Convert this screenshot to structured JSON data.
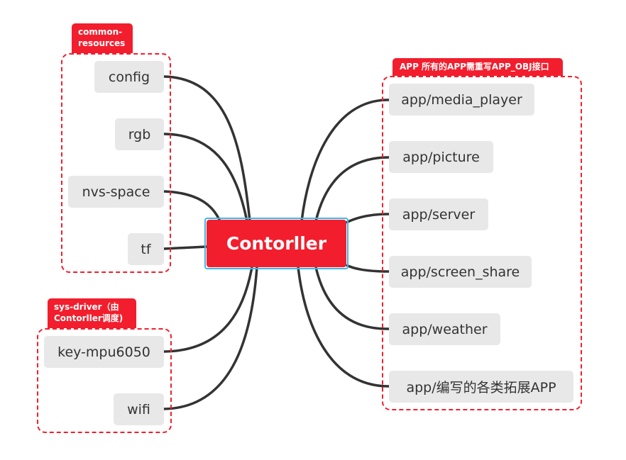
{
  "center": {
    "label": "Contorller"
  },
  "groups": {
    "common": {
      "label": "common-resources",
      "items": [
        "config",
        "rgb",
        "nvs-space",
        "tf"
      ]
    },
    "sys": {
      "label": "sys-driver（由Contorller调度)",
      "items": [
        "key-mpu6050",
        "wifi"
      ]
    },
    "app": {
      "label": "APP  所有的APP需重写APP_OBJ接口",
      "items": [
        "app/media_player",
        "app/picture",
        "app/server",
        "app/screen_share",
        "app/weather",
        "app/编写的各类拓展APP"
      ]
    }
  },
  "colors": {
    "accent": "#f21e2d",
    "node_bg": "#e8e8e8",
    "selection": "#3fb6e8",
    "line": "#333333"
  }
}
